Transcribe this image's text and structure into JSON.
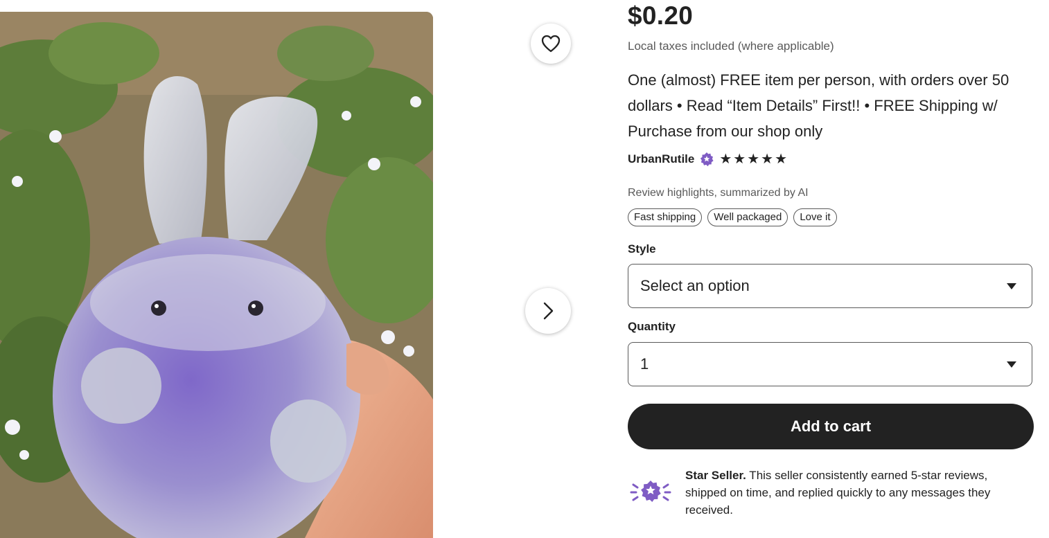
{
  "listing": {
    "price": "$0.20",
    "tax_note": "Local taxes included (where applicable)",
    "title": "One (almost) FREE item per person, with orders over 50 dollars • Read “Item Details” First!! • FREE Shipping w/ Purchase from our shop only"
  },
  "shop": {
    "name": "UrbanRutile",
    "badge_icon": "star-seller-badge-icon",
    "rating_stars": 5
  },
  "review_highlights": {
    "label": "Review highlights, summarized by AI",
    "chips": [
      "Fast shipping",
      "Well packaged",
      "Love it"
    ]
  },
  "style": {
    "label": "Style",
    "selected": "Select an option"
  },
  "quantity": {
    "label": "Quantity",
    "selected": "1"
  },
  "cart": {
    "label": "Add to cart"
  },
  "star_seller": {
    "title": "Star Seller.",
    "description": " This seller consistently earned 5-star reviews, shipped on time, and replied quickly to any messages they received."
  },
  "icons": {
    "favorite": "heart-icon",
    "next": "chevron-right-icon",
    "dropdown": "caret-down-icon"
  },
  "colors": {
    "primary_button": "#222222",
    "badge_purple": "#7f5cc4",
    "muted_text": "#595959"
  }
}
